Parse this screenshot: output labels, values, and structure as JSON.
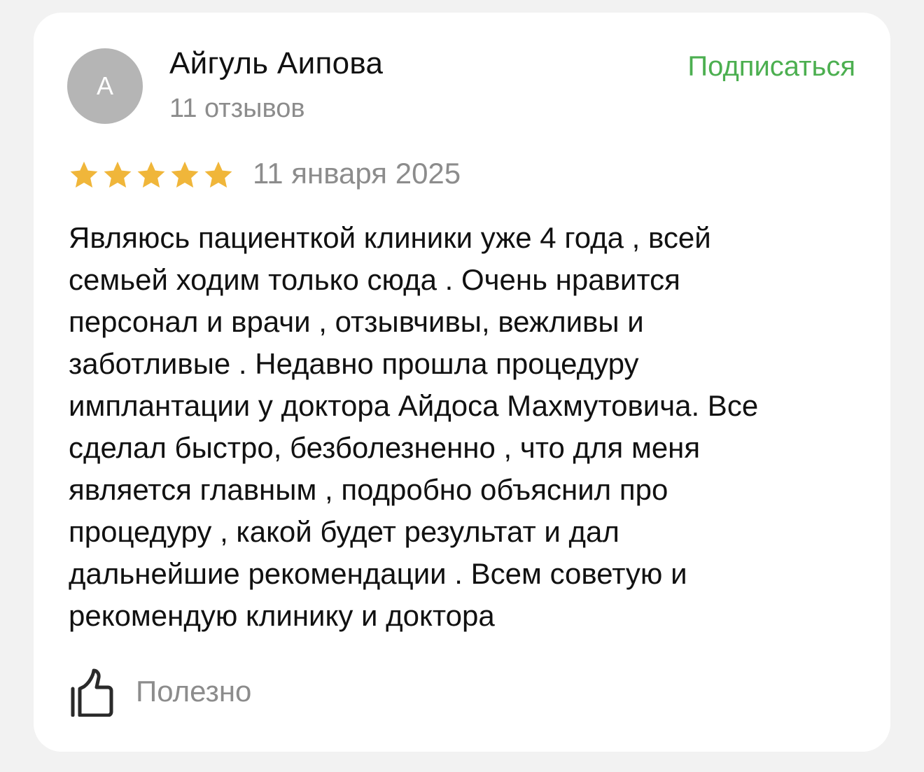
{
  "review": {
    "author": {
      "initial": "А",
      "name": "Айгуль Аипова",
      "review_count": "11 отзывов",
      "subscribe_label": "Подписаться"
    },
    "rating": {
      "value": 5,
      "max": 5
    },
    "date": "11 января 2025",
    "text": "Являюсь пациенткой клиники уже 4 года , всей\nсемьей ходим только сюда . Очень нравится\nперсонал и врачи , отзывчивы, вежливы и\nзаботливые . Недавно прошла процедуру\nимплантации у доктора Айдоса Махмутовича. Все\nсделал быстро, безболезненно , что для меня\nявляется главным , подробно объяснил про\nпроцедуру , какой будет результат и дал\nдальнейшие рекомендации . Всем советую и\nрекомендую клинику и доктора",
    "helpful_label": "Полезно"
  },
  "colors": {
    "accent_green": "#4caf50",
    "star_gold": "#f0b63a",
    "avatar_bg": "#b5b5b5",
    "muted_text": "#8c8c8c"
  },
  "icons": {
    "star": "star-icon",
    "helpful": "thumbs-up-icon"
  }
}
